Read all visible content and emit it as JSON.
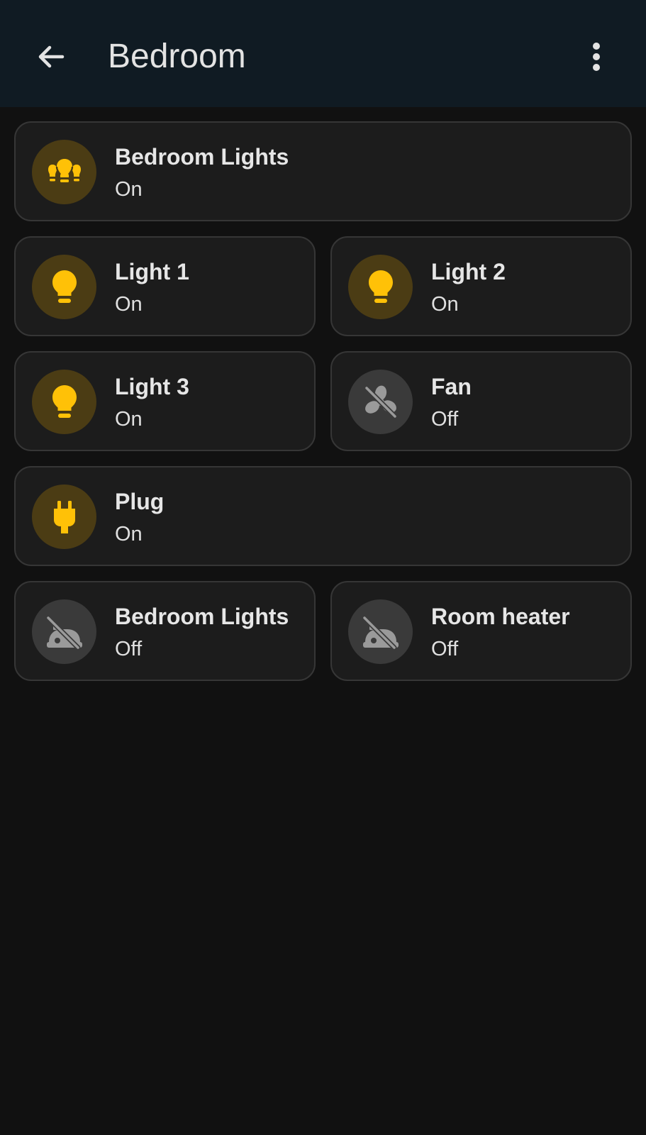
{
  "header": {
    "title": "Bedroom",
    "back_icon": "arrow-left-icon",
    "menu_icon": "dots-vertical-icon"
  },
  "colors": {
    "on": "#ffc107",
    "on_bg": "#4b3c14",
    "off": "#9a9a9a",
    "off_bg": "#3a3a3a"
  },
  "tiles": [
    {
      "name": "Bedroom Lights",
      "state": "On",
      "icon": "light-group-icon"
    },
    {
      "name": "Light 1",
      "state": "On",
      "icon": "lightbulb-icon"
    },
    {
      "name": "Light 2",
      "state": "On",
      "icon": "lightbulb-icon"
    },
    {
      "name": "Light 3",
      "state": "On",
      "icon": "lightbulb-icon"
    },
    {
      "name": "Fan",
      "state": "Off",
      "icon": "fan-off-icon"
    },
    {
      "name": "Plug",
      "state": "On",
      "icon": "power-plug-icon"
    },
    {
      "name": "Bedroom Lights",
      "state": "Off",
      "icon": "robot-off-icon"
    },
    {
      "name": "Room heater",
      "state": "Off",
      "icon": "robot-off-icon"
    }
  ]
}
